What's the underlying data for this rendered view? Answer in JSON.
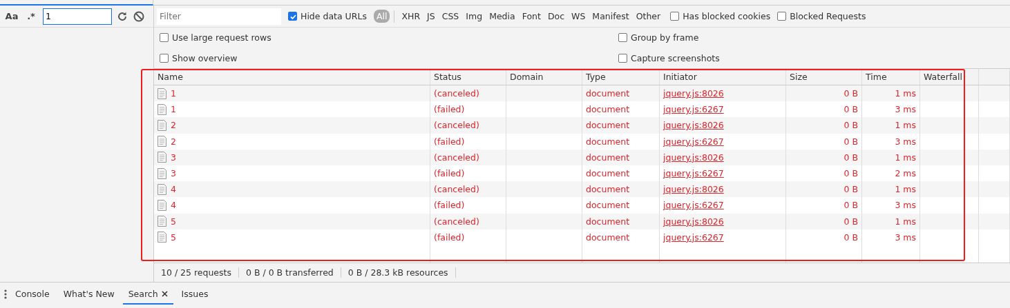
{
  "search_panel": {
    "case_toggle": "Aa",
    "regex_toggle": ".*",
    "query": "1"
  },
  "network": {
    "filter": {
      "placeholder": "Filter"
    },
    "hide_data_urls": {
      "label": "Hide data URLs",
      "checked": true
    },
    "type_filters": [
      {
        "label": "All",
        "selected": true
      },
      {
        "label": "XHR",
        "selected": false
      },
      {
        "label": "JS",
        "selected": false
      },
      {
        "label": "CSS",
        "selected": false
      },
      {
        "label": "Img",
        "selected": false
      },
      {
        "label": "Media",
        "selected": false
      },
      {
        "label": "Font",
        "selected": false
      },
      {
        "label": "Doc",
        "selected": false
      },
      {
        "label": "WS",
        "selected": false
      },
      {
        "label": "Manifest",
        "selected": false
      },
      {
        "label": "Other",
        "selected": false
      }
    ],
    "filter_options": [
      {
        "label": "Has blocked cookies",
        "checked": false
      },
      {
        "label": "Blocked Requests",
        "checked": false
      }
    ],
    "settings_left": [
      {
        "label": "Use large request rows",
        "checked": false
      },
      {
        "label": "Show overview",
        "checked": false
      }
    ],
    "settings_right": [
      {
        "label": "Group by frame",
        "checked": false
      },
      {
        "label": "Capture screenshots",
        "checked": false
      }
    ],
    "table": {
      "columns": [
        "Name",
        "Status",
        "Domain",
        "Type",
        "Initiator",
        "Size",
        "Time",
        "Waterfall"
      ],
      "rows": [
        {
          "name": "1",
          "status": "(canceled)",
          "type": "document",
          "initiator": "jquery.js:8026",
          "size": "0 B",
          "time": "1 ms"
        },
        {
          "name": "1",
          "status": "(failed)",
          "type": "document",
          "initiator": "jquery.js:6267",
          "size": "0 B",
          "time": "3 ms"
        },
        {
          "name": "2",
          "status": "(canceled)",
          "type": "document",
          "initiator": "jquery.js:8026",
          "size": "0 B",
          "time": "1 ms"
        },
        {
          "name": "2",
          "status": "(failed)",
          "type": "document",
          "initiator": "jquery.js:6267",
          "size": "0 B",
          "time": "3 ms"
        },
        {
          "name": "3",
          "status": "(canceled)",
          "type": "document",
          "initiator": "jquery.js:8026",
          "size": "0 B",
          "time": "1 ms"
        },
        {
          "name": "3",
          "status": "(failed)",
          "type": "document",
          "initiator": "jquery.js:6267",
          "size": "0 B",
          "time": "2 ms"
        },
        {
          "name": "4",
          "status": "(canceled)",
          "type": "document",
          "initiator": "jquery.js:8026",
          "size": "0 B",
          "time": "1 ms"
        },
        {
          "name": "4",
          "status": "(failed)",
          "type": "document",
          "initiator": "jquery.js:6267",
          "size": "0 B",
          "time": "3 ms"
        },
        {
          "name": "5",
          "status": "(canceled)",
          "type": "document",
          "initiator": "jquery.js:8026",
          "size": "0 B",
          "time": "1 ms"
        },
        {
          "name": "5",
          "status": "(failed)",
          "type": "document",
          "initiator": "jquery.js:6267",
          "size": "0 B",
          "time": "3 ms"
        }
      ]
    },
    "status_bar": [
      "10 / 25 requests",
      "0 B / 0 B transferred",
      "0 B / 28.3 kB resources"
    ]
  },
  "drawer_tabs": [
    {
      "label": "Console",
      "selected": false,
      "closable": false
    },
    {
      "label": "What's New",
      "selected": false,
      "closable": false
    },
    {
      "label": "Search",
      "selected": true,
      "closable": true
    },
    {
      "label": "Issues",
      "selected": false,
      "closable": false
    }
  ]
}
